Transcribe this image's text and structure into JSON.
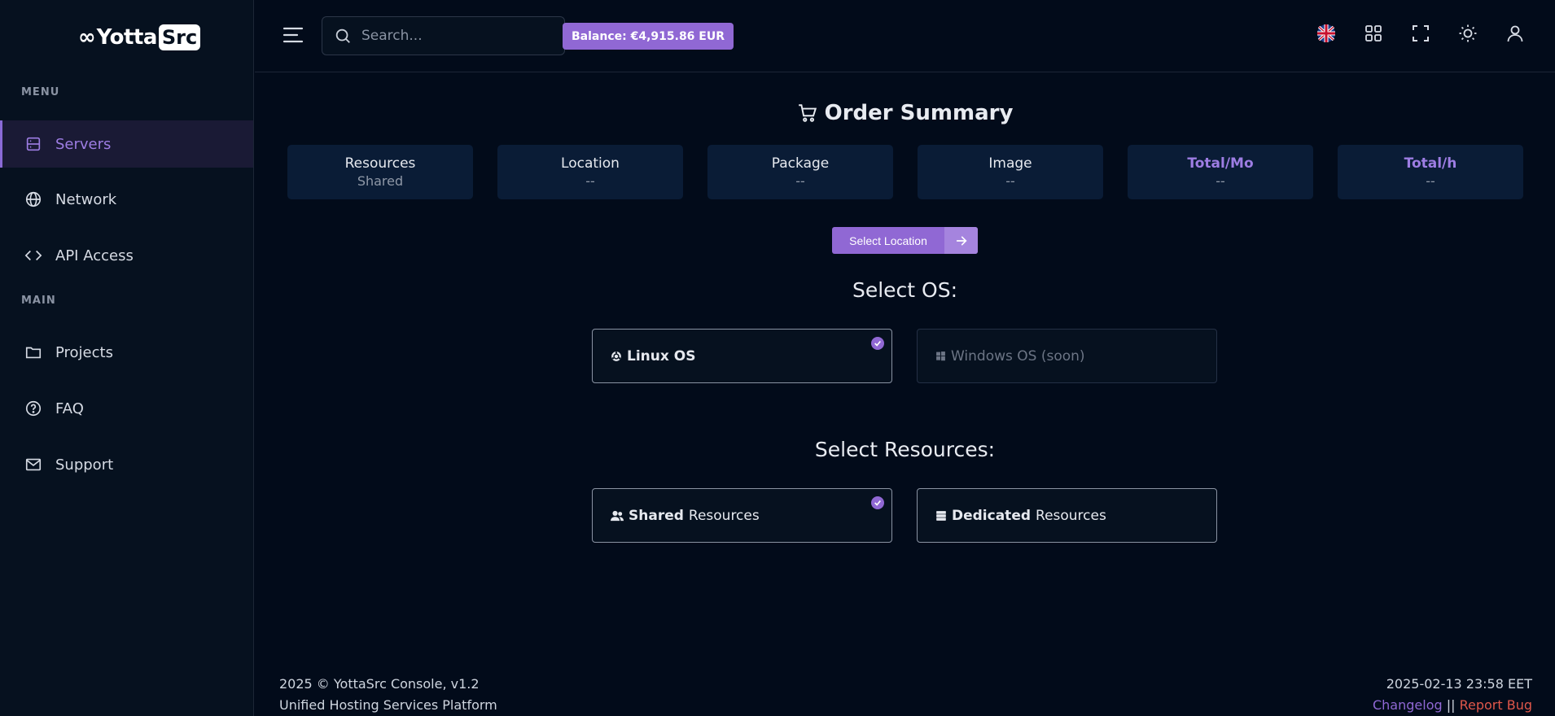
{
  "brand": {
    "mark": "∞",
    "text_prefix": "Yotta",
    "text_box": "Src"
  },
  "sidebar": {
    "section_menu": "MENU",
    "section_main": "MAIN",
    "menu_items": [
      {
        "label": "Servers",
        "icon": "server-icon",
        "active": true
      },
      {
        "label": "Network",
        "icon": "globe-icon"
      },
      {
        "label": "API Access",
        "icon": "code-icon"
      }
    ],
    "main_items": [
      {
        "label": "Projects",
        "icon": "folder-icon"
      },
      {
        "label": "FAQ",
        "icon": "question-circle-icon"
      },
      {
        "label": "Support",
        "icon": "mail-icon"
      }
    ]
  },
  "topbar": {
    "search_placeholder": "Search...",
    "balance": "Balance: €4,915.86 EUR",
    "icons": [
      "uk-flag-icon",
      "apps-grid-icon",
      "fullscreen-icon",
      "sun-icon",
      "user-icon"
    ]
  },
  "order": {
    "title": "Order Summary",
    "cards": [
      {
        "label": "Resources",
        "value": "Shared",
        "accent": false
      },
      {
        "label": "Location",
        "value": "--",
        "accent": false
      },
      {
        "label": "Package",
        "value": "--",
        "accent": false
      },
      {
        "label": "Image",
        "value": "--",
        "accent": false
      },
      {
        "label": "Total/Mo",
        "value": "--",
        "accent": true
      },
      {
        "label": "Total/h",
        "value": "--",
        "accent": true
      }
    ],
    "select_location_label": "Select Location"
  },
  "os": {
    "title": "Select OS:",
    "options": [
      {
        "label": "Linux OS",
        "selected": true,
        "disabled": false
      },
      {
        "label": "Windows OS (soon)",
        "selected": false,
        "disabled": true
      }
    ]
  },
  "resources": {
    "title": "Select Resources:",
    "options": [
      {
        "bold": "Shared",
        "rest": " Resources",
        "selected": true
      },
      {
        "bold": "Dedicated",
        "rest": " Resources",
        "selected": false
      }
    ]
  },
  "footer": {
    "copyright": "2025 © YottaSrc Console, v1.2",
    "tagline": "Unified Hosting Services Platform",
    "datetime": "2025-02-13 23:58 EET",
    "changelog": "Changelog",
    "separator": " || ",
    "report_bug": "Report Bug"
  },
  "colors": {
    "accent": "#9068d4",
    "bg": "#020b1a",
    "sidebar_bg": "#06111f",
    "card_bg": "#0a1c36",
    "danger": "#e0574a"
  }
}
